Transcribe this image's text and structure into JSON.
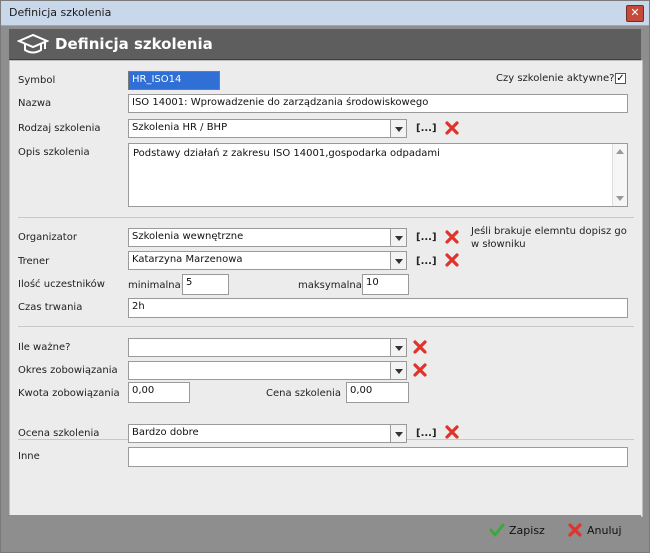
{
  "window": {
    "title": "Definicja szkolenia"
  },
  "header": {
    "title": "Definicja szkolenia"
  },
  "form": {
    "symbol": {
      "label": "Symbol",
      "value": "HR_ISO14"
    },
    "active": {
      "label": "Czy szkolenie aktywne?",
      "checked": "✓"
    },
    "nazwa": {
      "label": "Nazwa",
      "value": "ISO 14001: Wprowadzenie do zarządzania środowiskowego"
    },
    "rodzaj": {
      "label": "Rodzaj szkolenia",
      "value": "Szkolenia HR / BHP"
    },
    "opis": {
      "label": "Opis szkolenia",
      "value": "Podstawy działań z zakresu ISO 14001,gospodarka odpadami"
    },
    "organizator": {
      "label": "Organizator",
      "value": "Szkolenia wewnętrzne"
    },
    "hint": "Jeśli brakuje elemntu dopisz go w słowniku",
    "trener": {
      "label": "Trener",
      "value": "Katarzyna Marzenowa"
    },
    "uczestnicy": {
      "label": "Ilość uczestników",
      "min_label": "minimalna:",
      "min_value": "5",
      "max_label": "maksymalna:",
      "max_value": "10"
    },
    "czas": {
      "label": "Czas trwania",
      "value": "2h"
    },
    "ile_wazne": {
      "label": "Ile ważne?",
      "value": ""
    },
    "okres": {
      "label": "Okres zobowiązania",
      "value": ""
    },
    "kwota": {
      "label": "Kwota zobowiązania",
      "value": "0,00"
    },
    "cena": {
      "label": "Cena szkolenia",
      "value": "0,00"
    },
    "ocena": {
      "label": "Ocena szkolenia",
      "value": "Bardzo dobre"
    },
    "inne": {
      "label": "Inne",
      "value": ""
    },
    "dots_label": "[...]"
  },
  "footer": {
    "save_label": "Zapisz",
    "cancel_label": "Anuluj"
  },
  "colors": {
    "accent_red": "#e0332b",
    "save_green": "#3aa83a",
    "header_bg": "#5e5e5e"
  },
  "icons": {
    "header": "graduation-cap-icon",
    "delete": "red-x-icon",
    "save": "checkmark-icon",
    "cancel": "cancel-x-icon"
  }
}
